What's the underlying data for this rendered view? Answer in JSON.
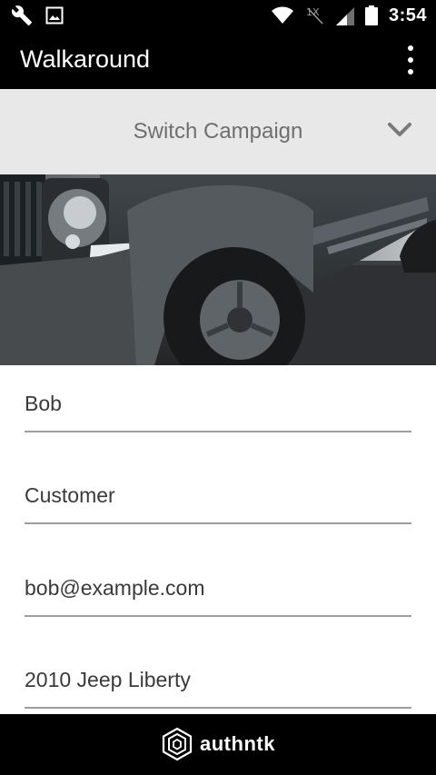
{
  "status_bar": {
    "time": "3:54",
    "left_icons": [
      "wrench-icon",
      "image-icon"
    ],
    "right_icons": [
      "wifi-icon",
      "mobile-data-off-icon",
      "cell-signal-icon",
      "battery-icon"
    ]
  },
  "app_bar": {
    "title": "Walkaround",
    "menu_icon": "overflow-menu-icon"
  },
  "campaign": {
    "label": "Switch Campaign",
    "icon": "chevron-down-icon"
  },
  "form": {
    "fields": [
      {
        "value": "Bob"
      },
      {
        "value": "Customer"
      },
      {
        "value": "bob@example.com"
      },
      {
        "value": "2010 Jeep Liberty"
      }
    ]
  },
  "footer": {
    "brand": "authntk",
    "logo_icon": "authntk-logo-icon"
  },
  "colors": {
    "bar_background": "#000000",
    "campaign_background": "#e8e8e8",
    "campaign_text": "#6f6f6f",
    "field_text": "#3a3a3a",
    "field_underline": "#9e9e9e"
  }
}
